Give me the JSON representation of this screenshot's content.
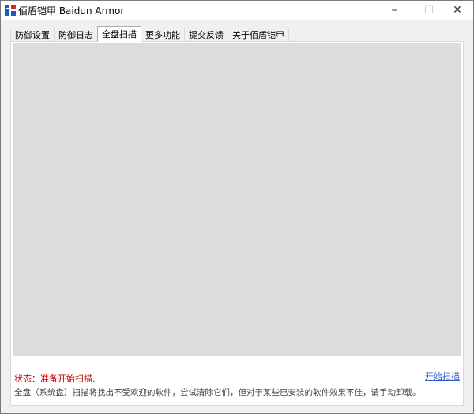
{
  "window": {
    "title": "佰盾铠甲 Baidun Armor",
    "controls": {
      "minimize": "–",
      "maximize": "☐",
      "close": "✕"
    },
    "icon": "baidun-armor-logo-icon"
  },
  "tabs": [
    {
      "label": "防御设置",
      "active": false
    },
    {
      "label": "防御日志",
      "active": false
    },
    {
      "label": "全盘扫描",
      "active": true
    },
    {
      "label": "更多功能",
      "active": false
    },
    {
      "label": "提交反馈",
      "active": false
    },
    {
      "label": "关于佰盾铠甲",
      "active": false
    }
  ],
  "scan": {
    "status": "状态：准备开始扫描.",
    "start_link": "开始扫描",
    "description": "全盘（系统盘）扫描将找出不受欢迎的软件，尝试清除它们，但对于某些已安装的软件效果不佳，请手动卸载。"
  },
  "colors": {
    "status": "#c00000",
    "link": "#2f5bd0",
    "scan_area": "#dcdcdc",
    "logo_red": "#d9271c",
    "logo_blue": "#1d5bbf"
  }
}
